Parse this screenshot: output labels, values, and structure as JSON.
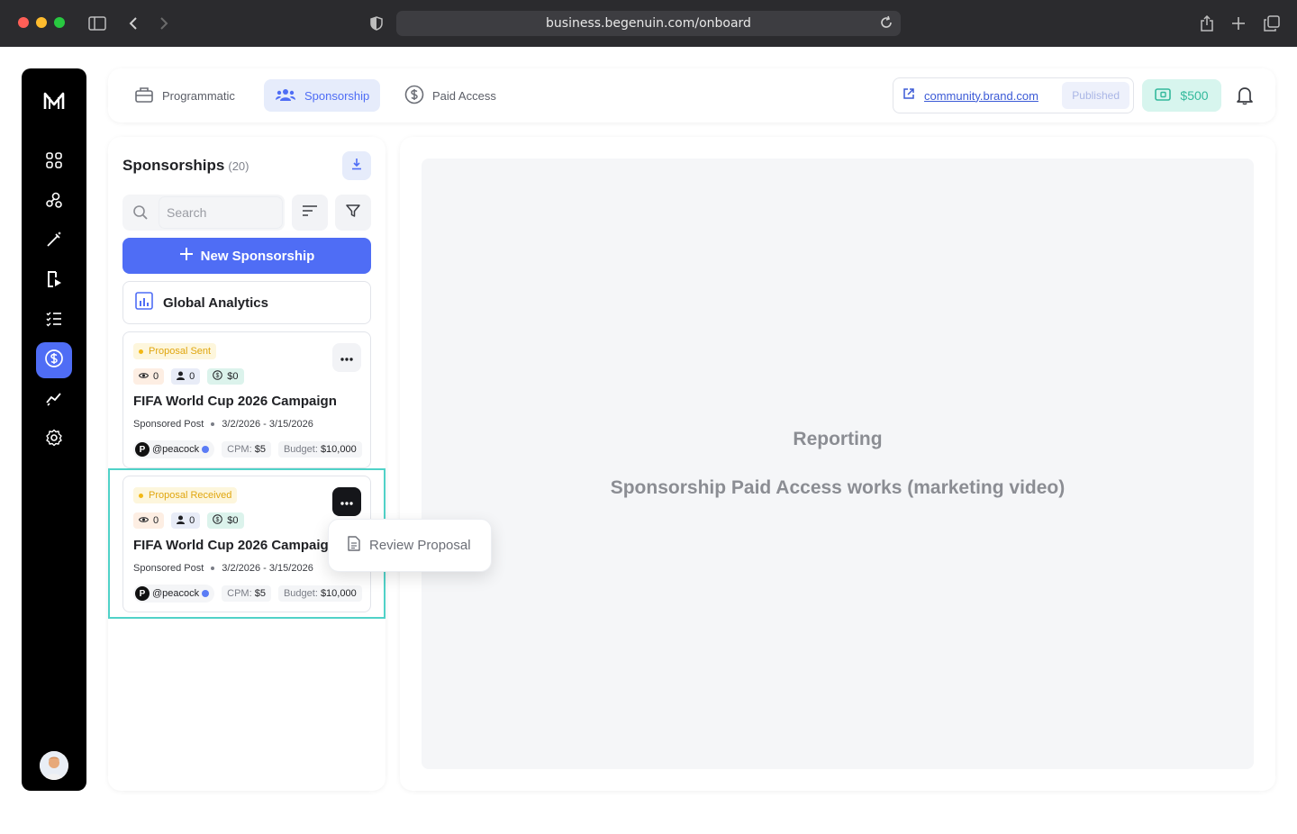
{
  "browser": {
    "url": "business.begenuin.com/onboard"
  },
  "nav_tabs": [
    {
      "label": "Programmatic",
      "icon": "briefcase-icon",
      "active": false
    },
    {
      "label": "Sponsorship",
      "icon": "users-icon",
      "active": true
    },
    {
      "label": "Paid Access",
      "icon": "dollar-circle-icon",
      "active": false
    }
  ],
  "header": {
    "community_link": "community.brand.com",
    "status": "Published",
    "balance": "$500"
  },
  "sidebar": {
    "items": [
      "grid-icon",
      "network-icon",
      "magic-wand-icon",
      "video-device-icon",
      "checklist-icon",
      "dollar-circle-icon",
      "trend-icon",
      "settings-icon"
    ],
    "active": "dollar-circle-icon"
  },
  "list": {
    "title": "Sponsorships",
    "count": "(20)",
    "search_placeholder": "Search",
    "new_button": "New Sponsorship",
    "analytics_button": "Global Analytics"
  },
  "cards": [
    {
      "status": "Proposal Sent",
      "views": "0",
      "users": "0",
      "earnings": "$0",
      "title": "FIFA World Cup 2026 Campaign",
      "type": "Sponsored Post",
      "dates": "3/2/2026 - 3/15/2026",
      "handle": "@peacock",
      "cpm_label": "CPM:",
      "cpm": "$5",
      "budget_label": "Budget:",
      "budget": "$10,000"
    },
    {
      "status": "Proposal Received",
      "views": "0",
      "users": "0",
      "earnings": "$0",
      "title": "FIFA World Cup 2026 Campaign",
      "type": "Sponsored Post",
      "dates": "3/2/2026 - 3/15/2026",
      "handle": "@peacock",
      "cpm_label": "CPM:",
      "cpm": "$5",
      "budget_label": "Budget:",
      "budget": "$10,000"
    }
  ],
  "dropdown": {
    "item": "Review Proposal"
  },
  "main": {
    "title": "Reporting",
    "subtitle": "Sponsorship Paid Access works (marketing video)"
  },
  "colors": {
    "accent": "#4f6df5",
    "status_yellow": "#f2b816",
    "balance_green": "#33b99c",
    "highlight": "#50d2c8"
  }
}
